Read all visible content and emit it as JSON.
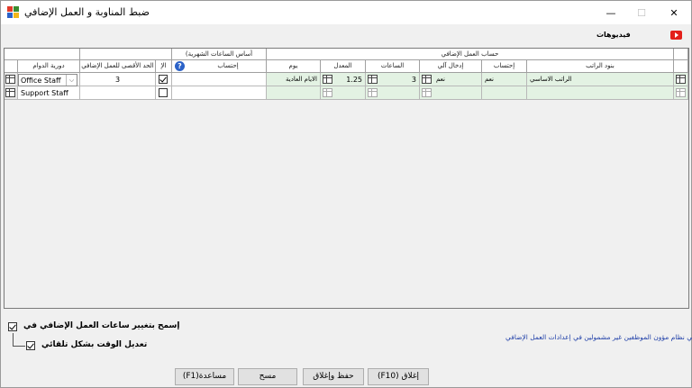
{
  "window": {
    "title": "ضبط المناوبة و العمل الإضافي",
    "controls": {
      "minimize": "—",
      "maximize": "☐",
      "close": "✕"
    }
  },
  "videos": {
    "label": "فيديوهات",
    "icon": "youtube-icon"
  },
  "grid": {
    "group_headers": {
      "overtime_calc": "حساب العمل الإضافي",
      "monthly_hours_basis": "(أساس الساعات الشهرية"
    },
    "columns": {
      "payroll_items": "بنود الراتب",
      "calculate": "إحتساب",
      "auto_entry": "إدخال آلي",
      "hours": "الساعات",
      "rate": "المعدل",
      "day": "يوم",
      "monthly_calculate": "إحتساب",
      "allow": "الإ",
      "max_overtime": "الحد الأقصى للعمل الإضافي",
      "shift": "دورية الدوام"
    },
    "rows": [
      {
        "payroll_item": "الراتب الاساسي",
        "calculate": "نعم",
        "auto_entry": "نعم",
        "hours": "3",
        "rate": "1.25",
        "day": "الايام العادية",
        "allow_checked": true,
        "max_overtime": "3",
        "shift": "Office Staff"
      },
      {
        "payroll_item": "",
        "calculate": "",
        "auto_entry": "",
        "hours": "",
        "rate": "",
        "day": "",
        "allow_checked": false,
        "max_overtime": "",
        "shift": "Support Staff"
      }
    ]
  },
  "options": {
    "allow_change_overtime": "إسمح بتغيير ساعات العمل الإضافي في",
    "allow_change_checked": true,
    "auto_adjust_time": "تعديل الوقت بشكل تلقائي",
    "auto_adjust_checked": true
  },
  "note": "موظفي نظام مؤون الموظفين غير مشمولين في إعدادات العمل الإضافي",
  "buttons": {
    "help": "(F1)مساعدة",
    "clear": "مسح",
    "save_close": "حفظ وإغلاق",
    "close": "(F10) إغلاق"
  },
  "colors": {
    "row_highlight": "#e3f2e3",
    "link": "#1f3fa8",
    "youtube": "#e3201b"
  }
}
